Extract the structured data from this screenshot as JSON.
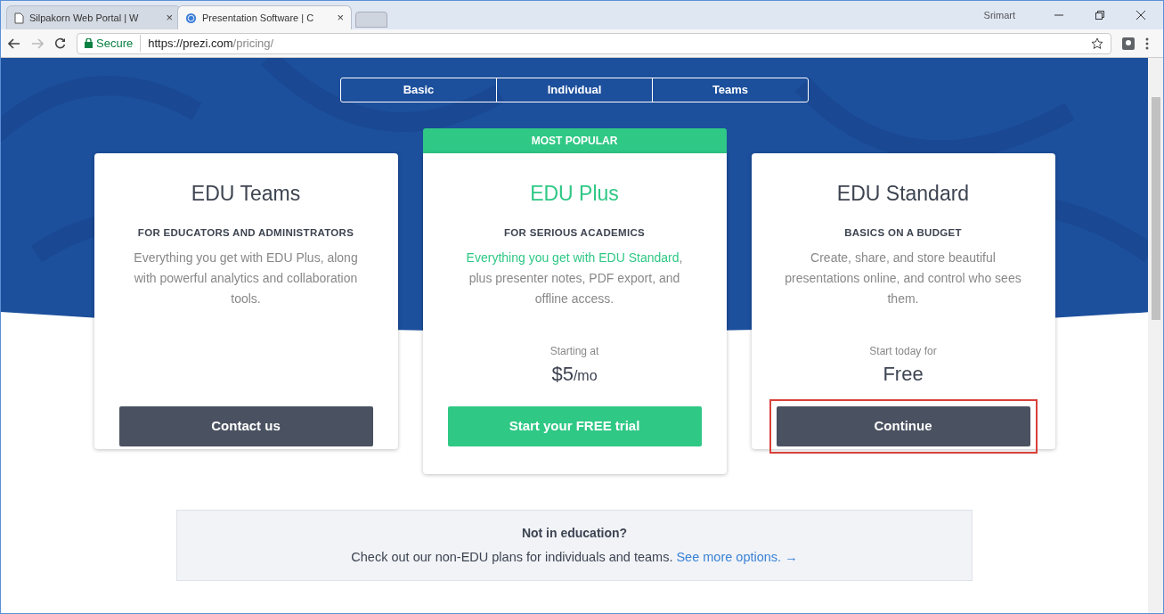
{
  "browser": {
    "tabs": [
      {
        "title": "Silpakorn Web Portal | W",
        "selected": false,
        "kind": "page"
      },
      {
        "title": "Presentation Software | C",
        "selected": true,
        "kind": "globe"
      }
    ],
    "close_glyph": "×",
    "user": "Srimart",
    "url_secure": "Secure",
    "url_host": "https://prezi.com",
    "url_path": "/pricing/"
  },
  "plan_tabs": [
    {
      "label": "Basic",
      "selected": false
    },
    {
      "label": "Individual",
      "selected": false
    },
    {
      "label": "Teams",
      "selected": false
    }
  ],
  "plans": [
    {
      "name": "EDU Teams",
      "featured": false,
      "subtitle": "FOR EDUCATORS AND ADMINISTRATORS",
      "description": "Everything you get with EDU Plus, along with powerful analytics and collaboration tools.",
      "button": "Contact us",
      "highlighted": false
    },
    {
      "name": "EDU Plus",
      "featured": true,
      "badge": "MOST POPULAR",
      "subtitle": "FOR SERIOUS ACADEMICS",
      "highlight": "Everything you get with EDU Standard",
      "description": ", plus presenter notes, PDF export, and offline access.",
      "price_note": "Starting at",
      "price": "$5",
      "price_unit": "/mo",
      "button": "Start your FREE trial",
      "highlighted": false
    },
    {
      "name": "EDU Standard",
      "featured": false,
      "subtitle": "BASICS ON A BUDGET",
      "description": "Create, share, and store beautiful presentations online, and control who sees them.",
      "price_note": "Start today for",
      "price": "Free",
      "button": "Continue",
      "highlighted": true
    }
  ],
  "footer_box": {
    "title": "Not in education?",
    "text": "Check out our non-EDU plans for individuals and teams.",
    "link": "See more options. →"
  }
}
